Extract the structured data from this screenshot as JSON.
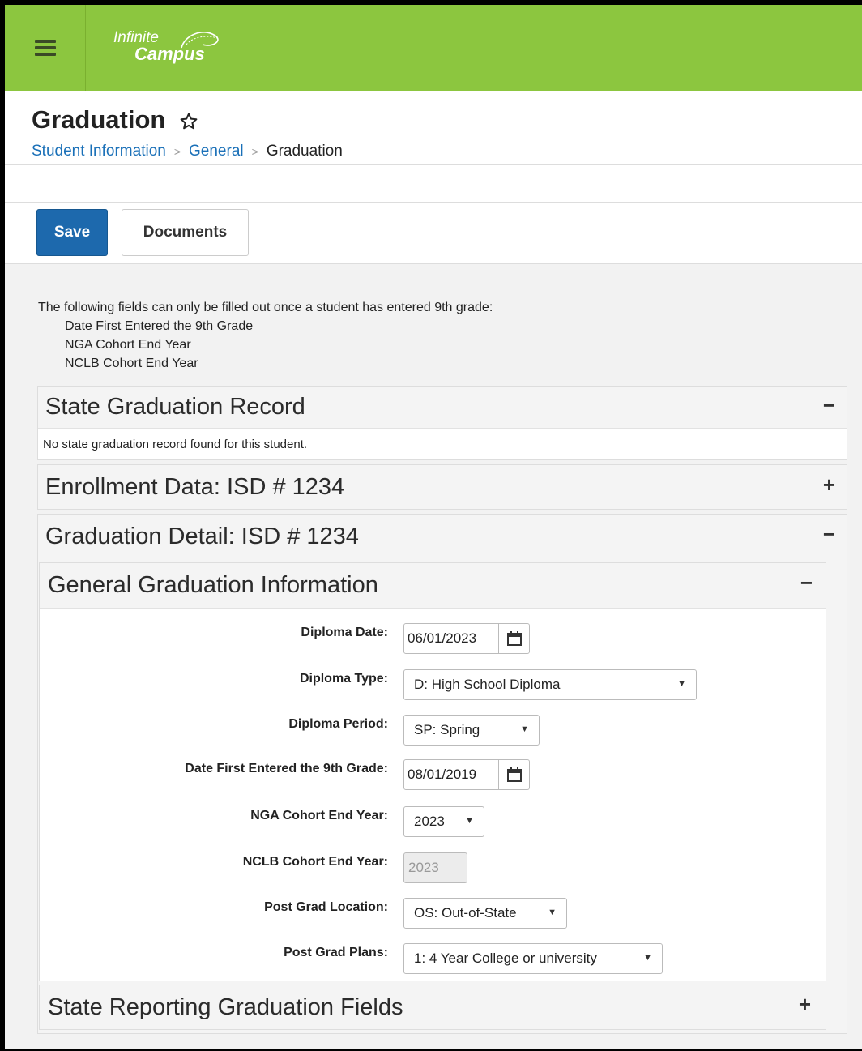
{
  "app": {
    "logo_line1": "Infinite",
    "logo_line2": "Campus",
    "brand_color": "#8cc63f",
    "accent_color": "#1d69ad"
  },
  "header": {
    "title": "Graduation",
    "breadcrumb": [
      "Student Information",
      "General",
      "Graduation"
    ]
  },
  "toolbar": {
    "save_label": "Save",
    "documents_label": "Documents"
  },
  "info": {
    "intro": "The following fields can only be filled out once a student has entered 9th grade:",
    "items": [
      "Date First Entered the 9th Grade",
      "NGA Cohort End Year",
      "NCLB Cohort End Year"
    ]
  },
  "panels": {
    "state_record": {
      "title": "State Graduation Record",
      "toggle": "−",
      "empty_message": "No state graduation record found for this student."
    },
    "enrollment": {
      "title": "Enrollment Data: ISD # 1234",
      "toggle": "+"
    },
    "graduation_detail": {
      "title": "Graduation Detail: ISD # 1234",
      "toggle": "−"
    },
    "general_info": {
      "title": "General Graduation Information",
      "toggle": "−"
    },
    "state_fields": {
      "title": "State Reporting Graduation Fields",
      "toggle": "+"
    }
  },
  "form": {
    "diploma_date": {
      "label": "Diploma Date:",
      "value": "06/01/2023"
    },
    "diploma_type": {
      "label": "Diploma Type:",
      "value": "D: High School Diploma"
    },
    "diploma_period": {
      "label": "Diploma Period:",
      "value": "SP: Spring"
    },
    "first_9th": {
      "label": "Date First Entered the 9th Grade:",
      "value": "08/01/2019"
    },
    "nga_year": {
      "label": "NGA Cohort End Year:",
      "value": "2023"
    },
    "nclb_year": {
      "label": "NCLB Cohort End Year:",
      "value": "2023"
    },
    "post_location": {
      "label": "Post Grad Location:",
      "value": "OS: Out-of-State"
    },
    "post_plans": {
      "label": "Post Grad Plans:",
      "value": "1: 4 Year College or university"
    }
  }
}
